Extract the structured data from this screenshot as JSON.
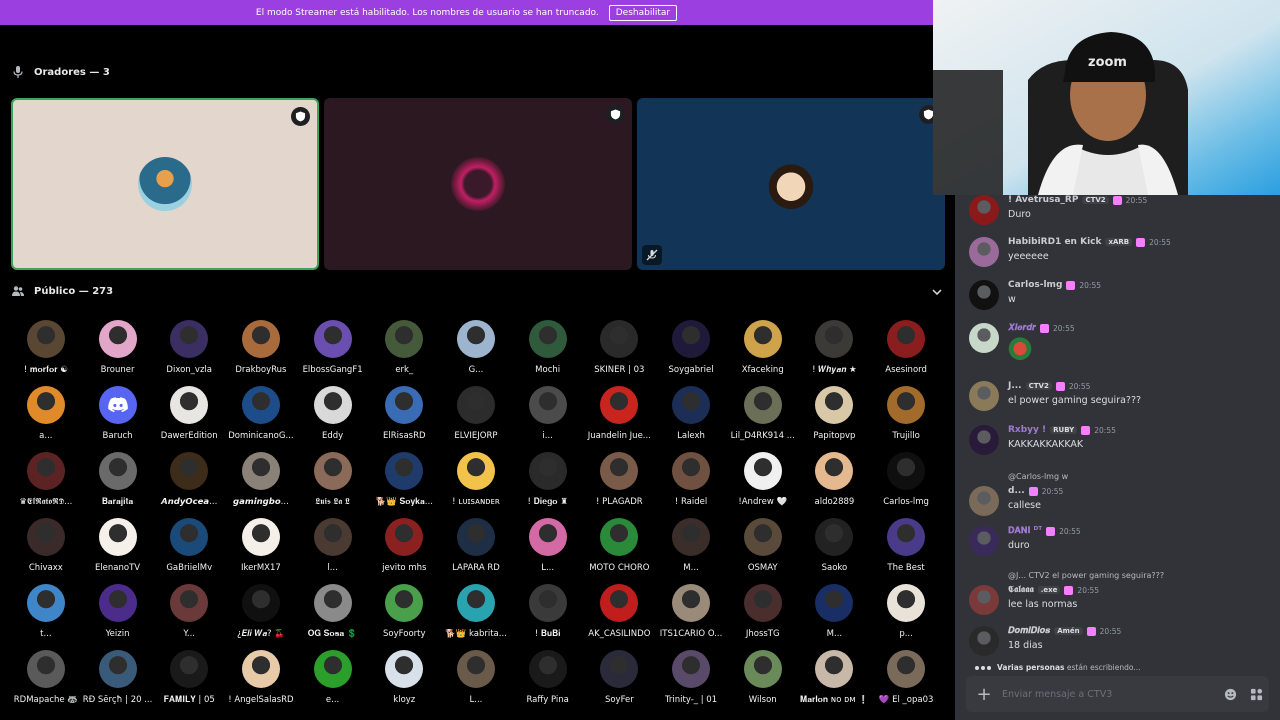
{
  "banner": {
    "text": "El modo Streamer está habilitado. Los nombres de usuario se han truncado.",
    "button": "Deshabilitar"
  },
  "speakers": {
    "header": "Oradores — 3",
    "tiles": [
      {
        "name": "speaker-1",
        "avatar_color": "#3a9fb5",
        "bg": "#e3d6cc"
      },
      {
        "name": "speaker-2",
        "avatar_color": "#c21f63",
        "bg": "#2b1820"
      },
      {
        "name": "speaker-3",
        "avatar_color": "#f1d7b8",
        "bg": "#123557"
      }
    ]
  },
  "audience": {
    "header": "Público — 273",
    "members": [
      {
        "name": "! 𝐦𝐨𝐫𝐟𝐨𝐫 ☯",
        "color": "#5a4733"
      },
      {
        "name": "Brouner",
        "color": "#e2a6c9"
      },
      {
        "name": "Dixon_vzla",
        "color": "#3b2e63"
      },
      {
        "name": "DrakboyRus",
        "color": "#a96b3c"
      },
      {
        "name": "ElbossGangF1",
        "color": "#6a4fb0"
      },
      {
        "name": "erk_",
        "color": "#445a3a"
      },
      {
        "name": "G...",
        "color": "#9db4cf"
      },
      {
        "name": "Mochi",
        "color": "#2f5a3c"
      },
      {
        "name": "SKINER | 03",
        "color": "#2a2a2a"
      },
      {
        "name": "Soygabriel",
        "color": "#1f1a3a"
      },
      {
        "name": "Xfaceking",
        "color": "#cfa24c"
      },
      {
        "name": "! 𝑾𝒉𝒚𝒂𝒏 ★",
        "color": "#3c3a36"
      },
      {
        "name": "Asesinord",
        "color": "#8a1e1e"
      },
      {
        "name": "a...",
        "color": "#e08a2a"
      },
      {
        "name": "Baruch",
        "color": "#5865f2",
        "discord": true
      },
      {
        "name": "DawerEdition",
        "color": "#e8e6e3"
      },
      {
        "name": "DominicanoG...",
        "color": "#1c4d8a"
      },
      {
        "name": "Eddy",
        "color": "#d9d9d9"
      },
      {
        "name": "ElRisasRD",
        "color": "#3a6bb5"
      },
      {
        "name": "ELVIEJORP",
        "color": "#2c2c2c"
      },
      {
        "name": "i...",
        "color": "#4b4b4b"
      },
      {
        "name": "Juandelin Jue...",
        "color": "#c7251d"
      },
      {
        "name": "Lalexh",
        "color": "#1c2e55"
      },
      {
        "name": "Lil_D4RK914 ...",
        "color": "#6b6f58"
      },
      {
        "name": "Papitopvp",
        "color": "#d8c8a8"
      },
      {
        "name": "Trujillo",
        "color": "#a26b2c"
      },
      {
        "name": "♛𝕰𝖑𝕽𝖆𝖙𝖔𝕽𝕯...",
        "color": "#5b2323"
      },
      {
        "name": "𝐁𝐚𝐫𝐚𝐣𝐢𝐭𝐚",
        "color": "#6a6a6a"
      },
      {
        "name": "𝘼𝙣𝙙𝙮𝙊𝙘𝙚𝙖...",
        "color": "#3d2c1a"
      },
      {
        "name": "𝙜𝙖𝙢𝙞𝙣𝙜𝙗𝙤...",
        "color": "#8a8276"
      },
      {
        "name": "𝕷𝖚𝖎𝖘 𝕷𝖆 𝕷",
        "color": "#8c6a5a"
      },
      {
        "name": "🐕👑 𝐒𝐨𝐲𝐤𝐚...",
        "color": "#1f3b6b"
      },
      {
        "name": "! ʟᴜɪsᴀɴᴅᴇʀ",
        "color": "#f2c24a"
      },
      {
        "name": "! 𝐃𝐢𝐞𝐠𝐨 ♜",
        "color": "#2a2a2a"
      },
      {
        "name": "! PLAGADR",
        "color": "#7a5a48"
      },
      {
        "name": "! Raidel",
        "color": "#705040"
      },
      {
        "name": "!Andrew 🤍",
        "color": "#f0f0f0"
      },
      {
        "name": "aldo2889",
        "color": "#e5b98f"
      },
      {
        "name": "Carlos-lmg",
        "color": "#0f0f0f"
      },
      {
        "name": "Chivaxx",
        "color": "#3a2a2a"
      },
      {
        "name": "ElenanoTV",
        "color": "#f5f0ea"
      },
      {
        "name": "GaBriielMv",
        "color": "#1a4a7a"
      },
      {
        "name": "IkerMX17",
        "color": "#f4efe9"
      },
      {
        "name": "l...",
        "color": "#4a3a32"
      },
      {
        "name": "jevito mhs",
        "color": "#8a2020"
      },
      {
        "name": "LAPARA RD",
        "color": "#1e2e45"
      },
      {
        "name": "L...",
        "color": "#d36aa6"
      },
      {
        "name": "MOTO CHORO",
        "color": "#2a8a3a"
      },
      {
        "name": "M...",
        "color": "#3b2d2a"
      },
      {
        "name": "OSMAY",
        "color": "#5a4a3a"
      },
      {
        "name": "Saoko",
        "color": "#222"
      },
      {
        "name": "The Best",
        "color": "#4a3a8a"
      },
      {
        "name": "t...",
        "color": "#3f86c9"
      },
      {
        "name": "Yeizin",
        "color": "#4b2c8a"
      },
      {
        "name": "Y...",
        "color": "#6a3a3a"
      },
      {
        "name": "¿𝑬𝒍𝒊 𝑾𝒂? 🍒",
        "color": "#101010"
      },
      {
        "name": "𝐎𝐆 𝐒𝐨𝐬𝐚 💲",
        "color": "#8a8a8a"
      },
      {
        "name": "SoyFoorty",
        "color": "#4aa04a"
      },
      {
        "name": "🐕👑 kabrita...",
        "color": "#2aa3b0"
      },
      {
        "name": "! 𝐁𝐮𝐁𝐢",
        "color": "#3a3a3a"
      },
      {
        "name": "AK_CASILINDO",
        "color": "#c01d1d"
      },
      {
        "name": "ITS1CARIO O...",
        "color": "#9a8a7a"
      },
      {
        "name": "JhossTG",
        "color": "#4a2e2e"
      },
      {
        "name": "M...",
        "color": "#1a2e66"
      },
      {
        "name": "p...",
        "color": "#e8e2d8"
      },
      {
        "name": "RDMapache 🦝",
        "color": "#5a5a5a"
      },
      {
        "name": "RĐ Šērçħ | 20 ...",
        "color": "#3a5a7a"
      },
      {
        "name": "𝐅𝐀𝐌𝐈𝐋𝐘 | 05",
        "color": "#1a1a1a"
      },
      {
        "name": "! AngelSalasRD",
        "color": "#e8c9a8"
      },
      {
        "name": "e...",
        "color": "#2aa02a"
      },
      {
        "name": "kloyz",
        "color": "#d8e0ea"
      },
      {
        "name": "L...",
        "color": "#6a5a4a"
      },
      {
        "name": "Raffy Pina",
        "color": "#1a1a1a"
      },
      {
        "name": "SoyFer",
        "color": "#2a2a3a"
      },
      {
        "name": "Trinity-_ | 01",
        "color": "#5a4a6a"
      },
      {
        "name": "Wilson",
        "color": "#6a8a5a"
      },
      {
        "name": "𝐌𝐚𝐫𝐥𝐨𝐧 ɴᴏ ᴅᴍ ❕",
        "color": "#c8b8a8"
      },
      {
        "name": "💜 El _opa03",
        "color": "#7a6a5a"
      }
    ]
  },
  "chat": {
    "messages": [
      {
        "author": "! Avetrusa_RP",
        "author_color": "#c9cdd2",
        "tag": "CTV2",
        "time": "20:55",
        "text": "Duro",
        "avatar_color": "#8a1a1a"
      },
      {
        "author": "HabibiRD1 en Kick",
        "author_color": "#c9cdd2",
        "tag": "xARB",
        "time": "20:55",
        "text": "yeeeeee",
        "avatar_color": "#9a6a9a"
      },
      {
        "author": "Carlos-lmg",
        "author_color": "#c9cdd2",
        "tag": "",
        "time": "20:55",
        "text": "w",
        "avatar_color": "#111"
      },
      {
        "author": "𝑿𝒍𝒆𝒓𝒅𝒓",
        "author_color": "#a07ad0",
        "tag": "",
        "time": "20:55",
        "text": "",
        "avatar_color": "#c8d8c8"
      },
      {
        "author": "J...",
        "author_color": "#c9cdd2",
        "tag": "CTV2",
        "time": "20:55",
        "text": "el power gaming seguira???",
        "avatar_color": "#8a7a5a"
      },
      {
        "author": "Rxbyy !",
        "author_color": "#a07ad0",
        "tag": "RUBY",
        "time": "20:55",
        "text": "KAKKAKKAKKAK",
        "avatar_color": "#2a1a3a"
      },
      {
        "author": "d...",
        "author_color": "#c9cdd2",
        "tag": "",
        "time": "20:55",
        "text": "callese",
        "avatar_color": "#7a6a5a",
        "reply": "@Carlos-lmg w"
      },
      {
        "author": "𝐃𝐀𝐍𝐈 ᴰᵀ",
        "author_color": "#a07ad0",
        "tag": "",
        "time": "20:55",
        "text": "duro",
        "avatar_color": "#3a2a5a"
      },
      {
        "author": "𝕮𝖆𝖑𝖆𝖆𝖆",
        "author_color": "#c9cdd2",
        "tag": ".exe",
        "time": "20:55",
        "text": "lee las normas",
        "avatar_color": "#7a3a3a",
        "reply": "@J... CTV2 el power gaming seguira???"
      },
      {
        "author": "𝑫𝒐𝒎𝒊𝑫𝒊𝒐𝒔",
        "author_color": "#c9cdd2",
        "tag": "Amén",
        "time": "20:55",
        "text": "18 dias",
        "avatar_color": "#2a2a2a"
      }
    ],
    "typing": {
      "who": "Varias personas",
      "suffix": "están escribiendo..."
    },
    "composer_placeholder": "Enviar mensaje a CTV3"
  }
}
